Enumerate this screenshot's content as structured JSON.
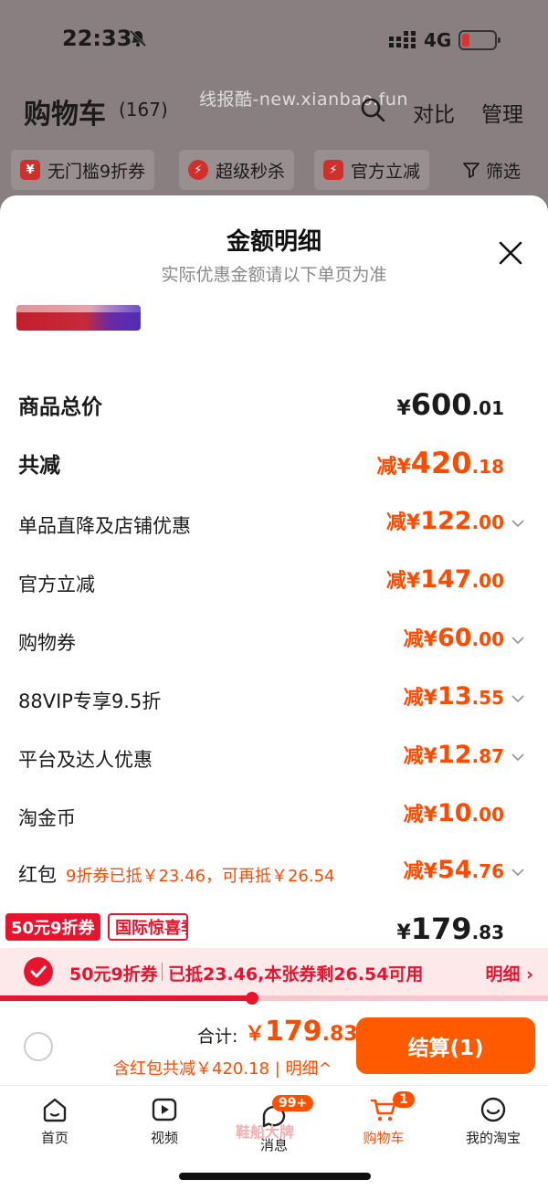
{
  "status_bar": {
    "time": "22:33",
    "network": "4G"
  },
  "header": {
    "title": "购物车",
    "count": "(167)",
    "watermark": "线报酷-new.xianbao.fun",
    "compare": "对比",
    "manage": "管理"
  },
  "filters": [
    {
      "label": "无门槛9折券",
      "icon": "coupon-icon"
    },
    {
      "label": "超级秒杀",
      "icon": "flash-icon"
    },
    {
      "label": "官方立减",
      "icon": "flash-icon"
    },
    {
      "label": "筛选",
      "icon": "filter-icon"
    }
  ],
  "sheet": {
    "title": "金额明细",
    "subtitle": "实际优惠金额请以下单页为准",
    "rows": [
      {
        "label": "商品总价",
        "prefix": "¥",
        "int": "600",
        "dec": ".01"
      },
      {
        "label": "共减",
        "prefix": "减¥",
        "int": "420",
        "dec": ".18"
      },
      {
        "label": "单品直降及店铺优惠",
        "prefix": "减¥",
        "int": "122",
        "dec": ".00"
      },
      {
        "label": "官方立减",
        "prefix": "减¥",
        "int": "147",
        "dec": ".00"
      },
      {
        "label": "购物券",
        "prefix": "减¥",
        "int": "60",
        "dec": ".00"
      },
      {
        "label": "88VIP专享9.5折",
        "prefix": "减¥",
        "int": "13",
        "dec": ".55"
      },
      {
        "label": "平台及达人优惠",
        "prefix": "减¥",
        "int": "12",
        "dec": ".87"
      },
      {
        "label": "淘金币",
        "prefix": "减¥",
        "int": "10",
        "dec": ".00"
      },
      {
        "label": "红包",
        "note": "9折券已抵￥23.46，可再抵￥26.54",
        "prefix": "减¥",
        "int": "54",
        "dec": ".76"
      },
      {
        "label": "",
        "prefix": "¥",
        "int": "179",
        "dec": ".83"
      }
    ]
  },
  "tags": {
    "red": "50元9折券",
    "outline": "国际惊喜季"
  },
  "coupon_bar": {
    "name": "50元9折券",
    "info": "已抵23.46,本张券剩26.54可用",
    "detail": "明细 ›",
    "progress": 0.46
  },
  "checkout": {
    "total_label": "合计:",
    "total_prefix": "￥",
    "total_int": "179",
    "total_dec": ".83",
    "sub": "含红包共减￥420.18 | 明细^",
    "button": "结算(1)"
  },
  "tabbar": [
    {
      "label": "首页",
      "icon": "home-icon"
    },
    {
      "label": "视频",
      "icon": "video-icon"
    },
    {
      "label": "消息",
      "icon": "message-icon",
      "badge": "99+"
    },
    {
      "label": "购物车",
      "icon": "cart-icon",
      "badge": "1"
    },
    {
      "label": "我的淘宝",
      "icon": "profile-icon"
    }
  ],
  "watermark2": "鞋船大牌"
}
